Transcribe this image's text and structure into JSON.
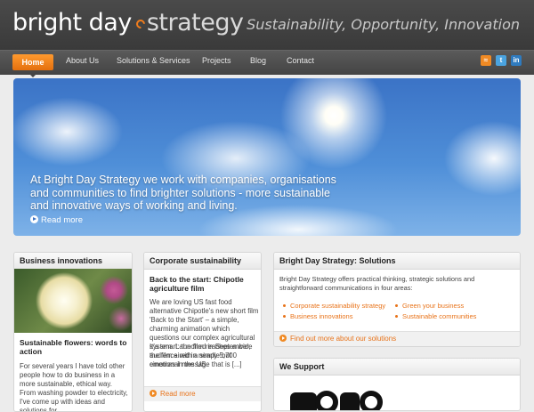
{
  "header": {
    "logo_word1": "bright day",
    "logo_word2": "strategy",
    "tagline": "Sustainability, Opportunity, Innovation"
  },
  "nav": {
    "items": [
      "Home",
      "About Us",
      "Solutions & Services",
      "Projects",
      "Blog",
      "Contact"
    ],
    "active": "Home"
  },
  "social": [
    "rss-icon",
    "twitter-icon",
    "linkedin-icon"
  ],
  "hero": {
    "text": "At Bright Day Strategy we work with companies, organisations and communities to find brighter solutions - more sustainable and innovative ways of working and living.",
    "more": "Read more"
  },
  "business_innovations": {
    "heading": "Business innovations",
    "article_title": "Sustainable flowers: words to action",
    "article_text": "For several years I have told other people how to do business in a more sustainable, ethical way.  From washing powder to electricity, I've come up with ideas and solutions for"
  },
  "corporate_sustainability": {
    "heading": "Corporate sustainability",
    "article_title": "Back to the start: Chipotle agriculture film",
    "article_text": "We are loving US fast food alternative Chipotle's new short film 'Back to the Start' – a simple, charming animation which questions our complex agricultural system. Launched in September, the film aired in  nearly 5,700 cinemas in the US.",
    "article_text2": "It's smart: the film reaches a wide audience with a simple but emotional message that is [...]",
    "more": "Read more"
  },
  "solutions": {
    "heading": "Bright Day Strategy: Solutions",
    "intro": "Bright Day Strategy offers practical thinking, strategic solutions and straightforward communications in four areas:",
    "links": [
      "Corporate sustainability strategy",
      "Business innovations",
      "Green your business",
      "Sustainable communities"
    ],
    "more": "Find out more about our solutions"
  },
  "we_support": {
    "heading": "We Support"
  },
  "colors": {
    "accent": "#f07c1c",
    "header": "#3f3f3f",
    "sky": "#4f8fd8"
  }
}
